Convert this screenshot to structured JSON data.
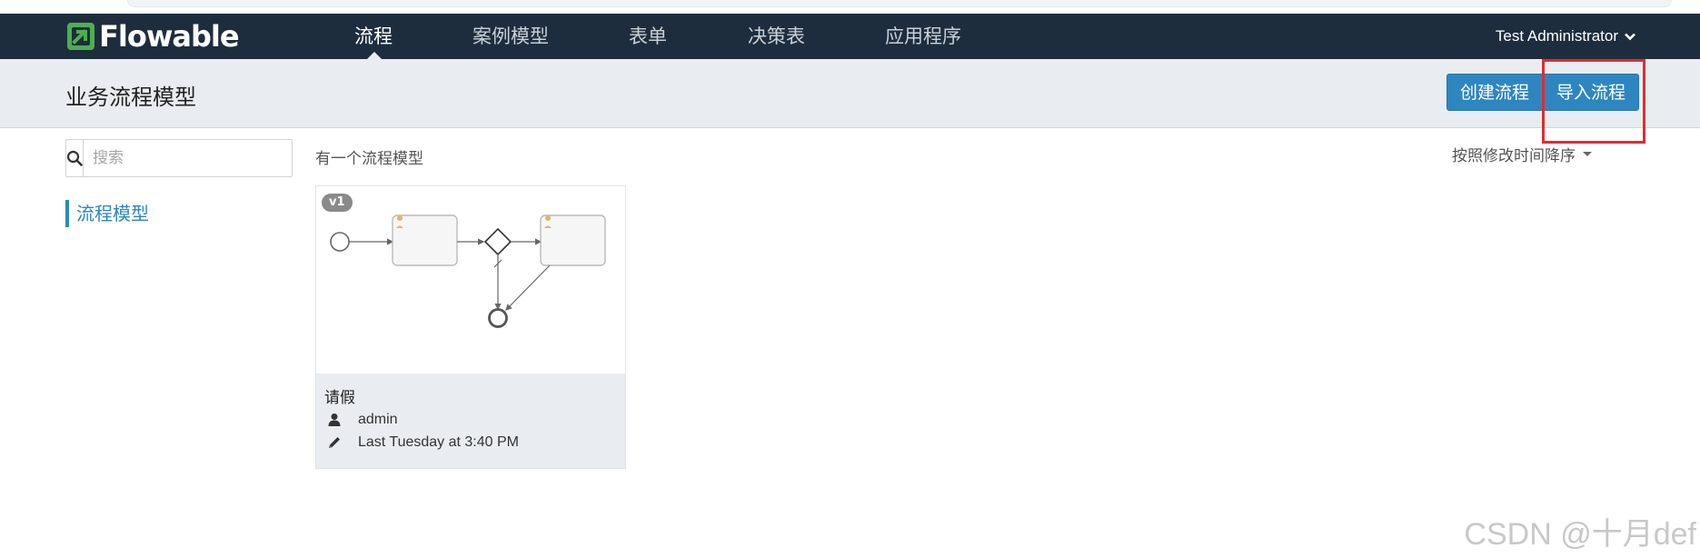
{
  "app": {
    "logo_text": "Flowable",
    "colors": {
      "navbar": "#1e2d3e",
      "accent": "#2e86c1",
      "logo_green": "#4caf50",
      "highlight": "#e52b2b"
    }
  },
  "nav": {
    "items": [
      {
        "label": "流程",
        "active": true
      },
      {
        "label": "案例模型",
        "active": false
      },
      {
        "label": "表单",
        "active": false
      },
      {
        "label": "决策表",
        "active": false
      },
      {
        "label": "应用程序",
        "active": false
      }
    ],
    "user": "Test Administrator"
  },
  "header": {
    "title": "业务流程模型",
    "create_button": "创建流程",
    "import_button": "导入流程"
  },
  "sidebar": {
    "search_placeholder": "搜索",
    "items": [
      {
        "label": "流程模型"
      }
    ]
  },
  "main": {
    "result_count": "有一个流程模型",
    "sort_label": "按照修改时间降序",
    "models": [
      {
        "version": "v1",
        "name": "请假",
        "owner": "admin",
        "modified": "Last Tuesday at 3:40 PM",
        "owner_icon": "user-icon",
        "modified_icon": "pencil-icon"
      }
    ]
  },
  "watermark": "CSDN @十月def"
}
